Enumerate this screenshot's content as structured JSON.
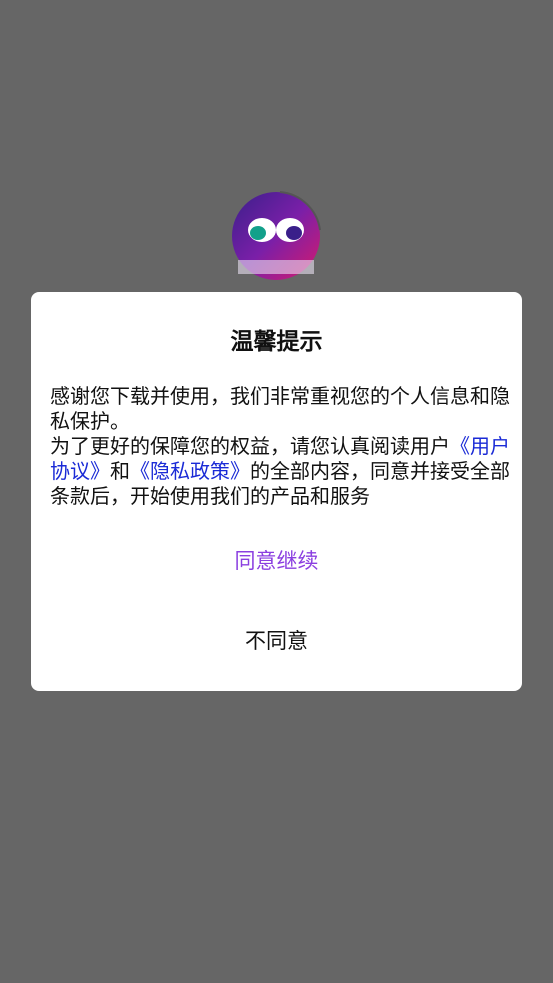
{
  "dialog": {
    "title": "温馨提示",
    "para1": "感谢您下载并使用，我们非常重视您的个人信息和隐私保护。",
    "para2_prefix": "为了更好的保障您的权益，请您认真阅读用户",
    "user_agreement_link": "《用户协议》",
    "and_text": "和",
    "privacy_policy_link": "《隐私政策》",
    "para2_suffix": "的全部内容，同意并接受全部条款后，开始使用我们的产品和服务",
    "agree_label": "同意继续",
    "disagree_label": "不同意"
  },
  "logo": {
    "icon": "app-logo-icon",
    "colors": {
      "primary": "#7a1fa8",
      "accent": "#d81b6c",
      "eye": "#12a08a"
    }
  },
  "colors": {
    "overlay": "#666666",
    "link": "#1a2ad6",
    "agree": "#8b3fe0"
  }
}
